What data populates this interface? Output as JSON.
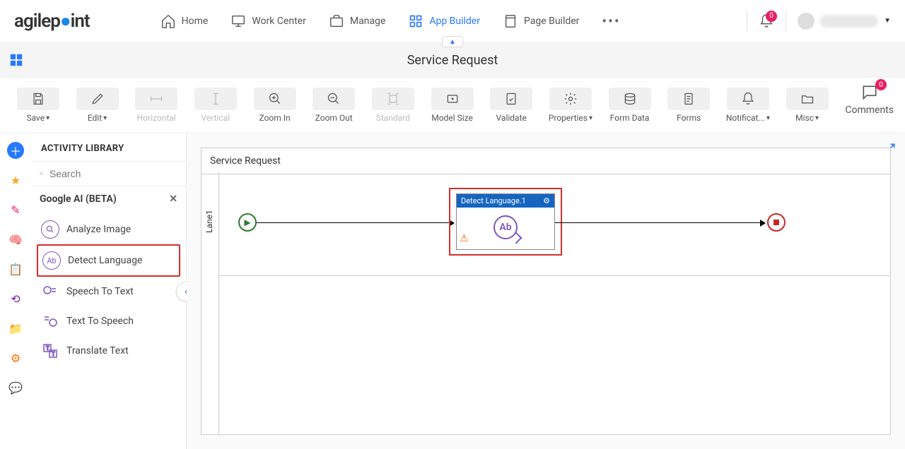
{
  "brand": "agilepoint",
  "nav": {
    "home": "Home",
    "work_center": "Work Center",
    "manage": "Manage",
    "app_builder": "App Builder",
    "page_builder": "Page Builder",
    "bell_count": "0"
  },
  "subheader": {
    "title": "Service Request"
  },
  "toolbar": {
    "save": "Save",
    "edit": "Edit",
    "horizontal": "Horizontal",
    "vertical": "Vertical",
    "zoom_in": "Zoom In",
    "zoom_out": "Zoom Out",
    "standard": "Standard",
    "model_size": "Model Size",
    "validate": "Validate",
    "properties": "Properties",
    "form_data": "Form Data",
    "forms": "Forms",
    "notifications": "Notificat...",
    "misc": "Misc",
    "comments": "Comments",
    "comments_count": "0"
  },
  "panel": {
    "title": "ACTIVITY LIBRARY",
    "search_placeholder": "Search",
    "category": "Google AI (BETA)",
    "items": {
      "analyze_image": "Analyze Image",
      "detect_language": "Detect Language",
      "speech_to_text": "Speech To Text",
      "text_to_speech": "Text To Speech",
      "translate_text": "Translate Text"
    }
  },
  "canvas": {
    "title": "Service Request",
    "lane": "Lane1",
    "node_title": "Detect Language.1"
  }
}
